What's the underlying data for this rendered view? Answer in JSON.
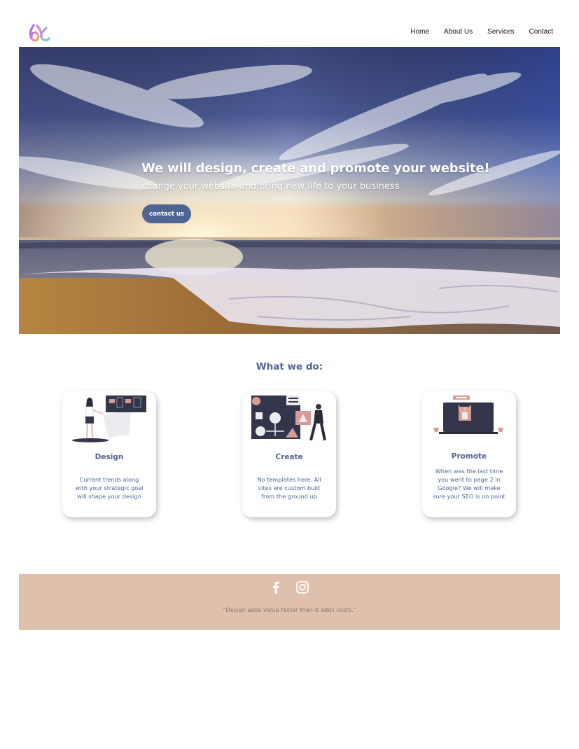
{
  "header": {
    "logo_icon": "brand-logo-icon",
    "nav": [
      {
        "label": "Home"
      },
      {
        "label": "About Us"
      },
      {
        "label": "Services"
      },
      {
        "label": "Contact"
      }
    ]
  },
  "hero": {
    "title": "We will design, create and promote your website!",
    "subtitle": "change your website and bring new life to your business",
    "button_label": "contact us",
    "image": "beach-sunset-photo"
  },
  "services": {
    "title": "What we do:",
    "cards": [
      {
        "title": "Design",
        "text": "Current trends along with your strategic goal will shape your design",
        "illustration": "design-illustration"
      },
      {
        "title": "Create",
        "text": "No templates here. All sites are custom built from the ground up",
        "illustration": "create-illustration"
      },
      {
        "title": "Promote",
        "text": "When was the last time you went to page 2 in Google? We will make sure your SEO is on point",
        "illustration": "promote-illustration"
      }
    ]
  },
  "footer": {
    "social": [
      {
        "icon": "facebook-icon"
      },
      {
        "icon": "instagram-icon"
      }
    ],
    "quote": "“Design adds value faster than it adds costs.”"
  },
  "colors": {
    "accent": "#4e6591",
    "footer_bg": "#dfc0ad",
    "quote_text": "#8a7466"
  }
}
